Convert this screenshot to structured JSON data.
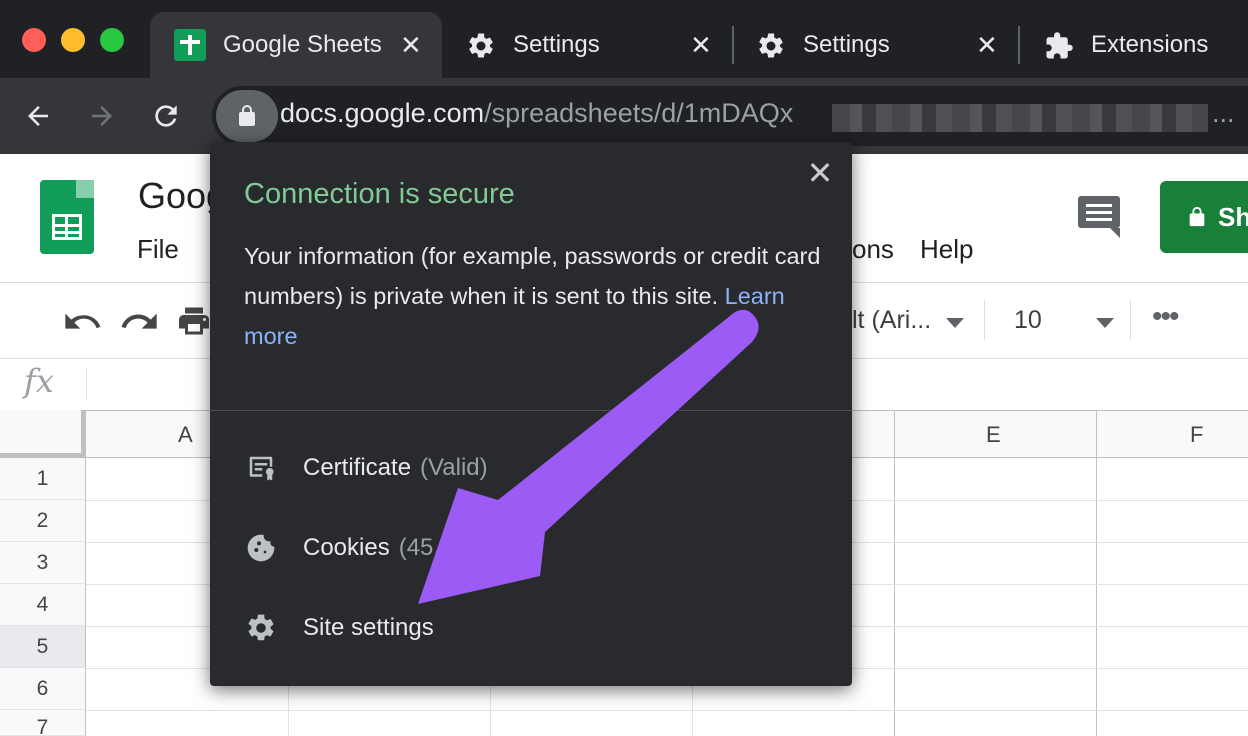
{
  "browser": {
    "tabs": [
      {
        "title": "Google Sheets",
        "active": true
      },
      {
        "title": "Settings",
        "active": false
      },
      {
        "title": "Settings",
        "active": false
      },
      {
        "title": "Extensions",
        "active": false
      }
    ],
    "tab_close_glyph": "✕",
    "url_host": "docs.google.com",
    "url_path": "/spreadsheets/d/1mDAQx",
    "url_overflow": "..."
  },
  "sheets": {
    "title": "Goog",
    "menu": [
      "File",
      "ons",
      "Help"
    ],
    "share_label": "Sh",
    "font_name": "lt (Ari...",
    "font_size": "10",
    "more": "•••",
    "formula_icon": "fx",
    "columns": [
      "A",
      "E",
      "F"
    ],
    "rows": [
      "1",
      "2",
      "3",
      "4",
      "5",
      "6",
      "7"
    ]
  },
  "popup": {
    "close_glyph": "✕",
    "title": "Connection is secure",
    "body": "Your information (for example, passwords or credit card numbers) is private when it is sent to this site.",
    "learn_more": "Learn more",
    "certificate_label": "Certificate",
    "certificate_status": "(Valid)",
    "cookies_label": "Cookies",
    "cookies_count": "(45",
    "cookies_count_tail": ")",
    "site_settings_label": "Site settings"
  },
  "colors": {
    "secure_green": "#81c995",
    "link_blue": "#8ab4f8",
    "annotation_arrow": "#9c5bf5",
    "sheets_green": "#0f9d58"
  },
  "icons": [
    "sheets-favicon",
    "gear-icon",
    "puzzle-icon",
    "back-arrow-icon",
    "forward-arrow-icon",
    "reload-icon",
    "lock-icon",
    "comment-icon",
    "undo-icon",
    "redo-icon",
    "print-icon",
    "certificate-icon",
    "cookie-icon",
    "gear-icon",
    "close-icon"
  ]
}
